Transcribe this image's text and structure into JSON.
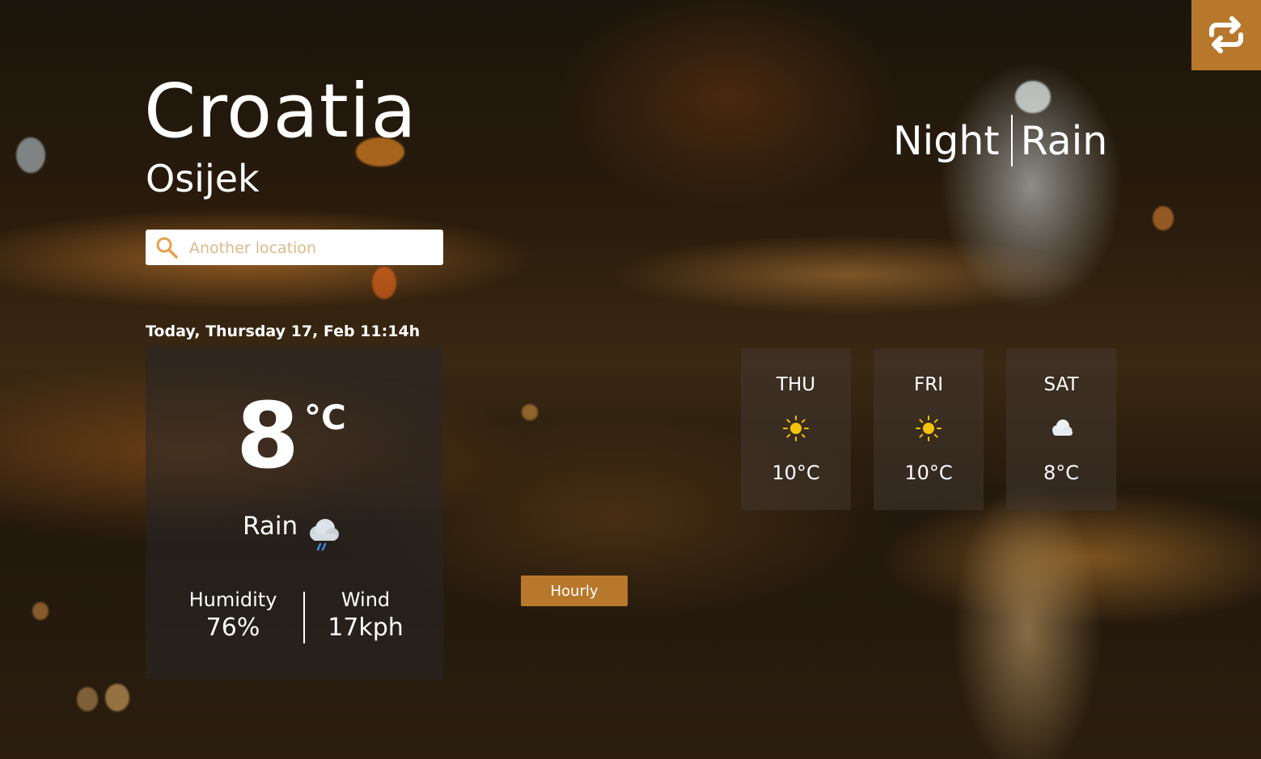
{
  "location": {
    "country": "Croatia",
    "city": "Osijek"
  },
  "search": {
    "placeholder": "Another location"
  },
  "status": {
    "time_of_day": "Night",
    "condition": "Rain"
  },
  "current": {
    "datetime": "Today, Thursday 17, Feb 11:14h",
    "temperature": "8",
    "unit": "°C",
    "condition": "Rain",
    "condition_icon": "rain-cloud-icon",
    "humidity_label": "Humidity",
    "humidity_value": "76%",
    "wind_label": "Wind",
    "wind_value": "17kph"
  },
  "forecast": [
    {
      "day": "THU",
      "icon": "sun-icon",
      "temp": "10°C"
    },
    {
      "day": "FRI",
      "icon": "sun-icon",
      "temp": "10°C"
    },
    {
      "day": "SAT",
      "icon": "cloud-icon",
      "temp": "8°C"
    }
  ],
  "buttons": {
    "hourly_label": "Hourly",
    "switch_icon": "swap-arrows-icon"
  },
  "colors": {
    "accent": "#b8782c",
    "panel": "#282628",
    "placeholder": "#e0b98a",
    "sun": "#f5c400"
  }
}
